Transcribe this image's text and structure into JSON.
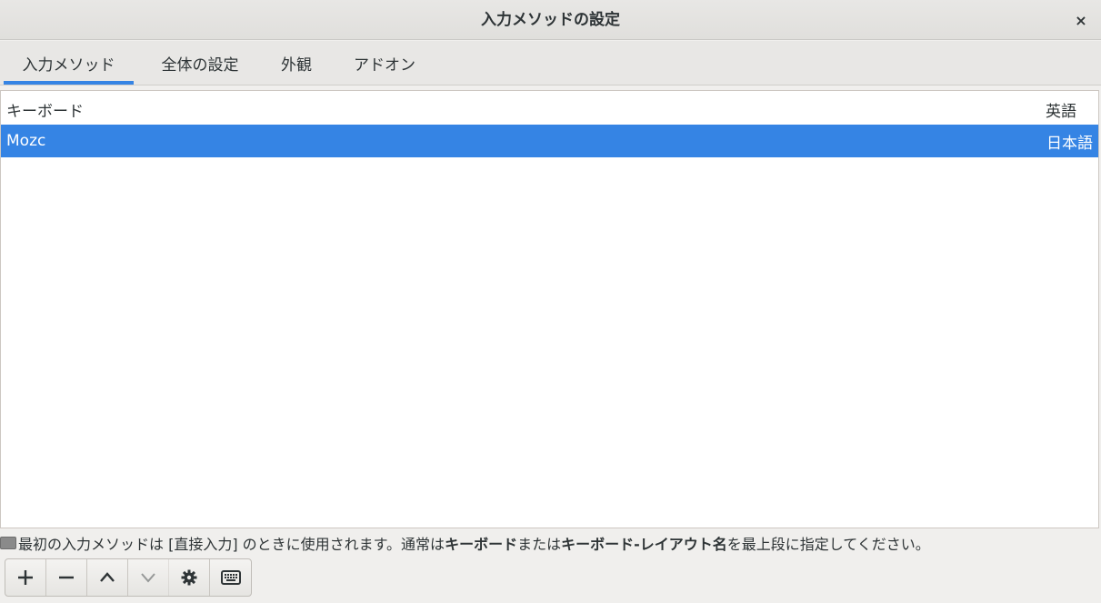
{
  "window": {
    "title": "入力メソッドの設定",
    "close_glyph": "×"
  },
  "tabs": [
    {
      "label": "入力メソッド",
      "active": true
    },
    {
      "label": "全体の設定",
      "active": false
    },
    {
      "label": "外観",
      "active": false
    },
    {
      "label": "アドオン",
      "active": false
    }
  ],
  "list": {
    "header": {
      "name": "キーボード",
      "language": "英語"
    },
    "selected": {
      "name": "Mozc",
      "language": "日本語"
    }
  },
  "hint": {
    "part1": "最初の入力メソッドは [直接入力] のときに使用されます。通常は ",
    "bold1": "キーボード",
    "part2": " または ",
    "bold2": "キーボード-レイアウト名",
    "part3": " を最上段に指定してください。"
  },
  "toolbar": {
    "buttons": [
      {
        "icon": "plus-icon",
        "enabled": true
      },
      {
        "icon": "minus-icon",
        "enabled": true
      },
      {
        "icon": "chevron-up-icon",
        "enabled": true
      },
      {
        "icon": "chevron-down-icon",
        "enabled": false
      },
      {
        "icon": "gear-icon",
        "enabled": true
      },
      {
        "icon": "keyboard-icon",
        "enabled": true
      }
    ]
  },
  "colors": {
    "accent": "#3584e4",
    "background": "#f0efed",
    "text": "#2e3436"
  }
}
